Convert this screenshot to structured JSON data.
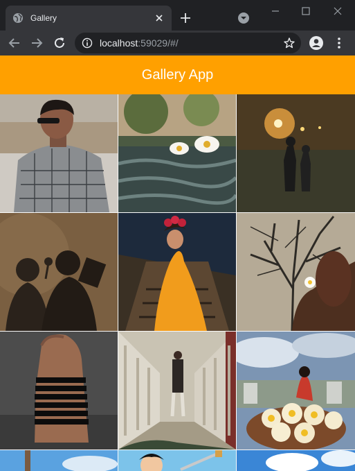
{
  "browser": {
    "tab_title": "Gallery",
    "url_host": "localhost",
    "url_rest": ":59029/#/",
    "icons": {
      "favicon": "globe-icon",
      "tab_close": "close-icon",
      "new_tab": "plus-icon",
      "tab_search": "chevron-down-icon",
      "minimize": "minimize-icon",
      "maximize": "maximize-icon",
      "window_close": "close-icon",
      "back": "arrow-left-icon",
      "forward": "arrow-right-icon",
      "reload": "reload-icon",
      "site_info": "info-icon",
      "bookmark": "star-icon",
      "profile": "account-icon",
      "menu": "kebab-menu-icon"
    }
  },
  "app": {
    "title": "Gallery App",
    "accent_color": "#ffa000"
  },
  "gallery": {
    "photos": [
      "man-in-checked-shirt-with-sunglasses",
      "white-flowers-on-leaves",
      "couple-silhouette-at-night-with-lights",
      "shadows-on-wall-holding-flower-and-book",
      "woman-in-yellow-saree-on-boat",
      "flower-held-against-bare-tree",
      "hand-with-black-bracelets",
      "man-walking-in-corridor",
      "woman-on-rooftop-and-frangipani-bowl",
      "blue-sky-with-wooden-post",
      "cartoon-character-with-sword",
      "blue-sky-with-clouds"
    ]
  }
}
